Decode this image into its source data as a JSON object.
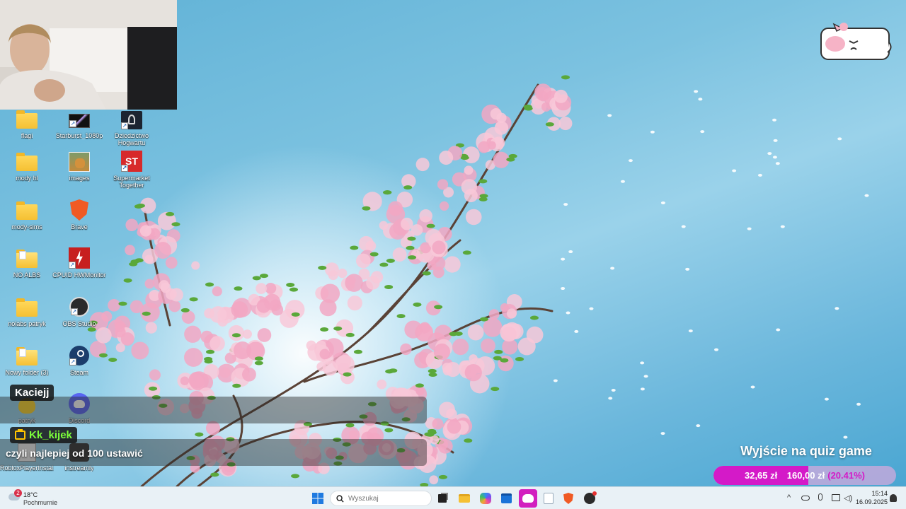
{
  "desktop_icons": [
    {
      "label": "flagi",
      "type": "folder",
      "col": 0,
      "row": 0
    },
    {
      "label": "Starburst_1080p",
      "type": "video",
      "col": 1,
      "row": 0
    },
    {
      "label": "Dziedzictwo Hogwartu",
      "type": "game",
      "col": 2,
      "row": 0
    },
    {
      "label": "mody hl",
      "type": "folder",
      "col": 0,
      "row": 1
    },
    {
      "label": "images",
      "type": "image",
      "col": 1,
      "row": 1
    },
    {
      "label": "Supermarket Together",
      "type": "st",
      "col": 2,
      "row": 1
    },
    {
      "label": "mody-sims",
      "type": "folder",
      "col": 0,
      "row": 2
    },
    {
      "label": "Brave",
      "type": "brave",
      "col": 1,
      "row": 2
    },
    {
      "label": "NO ALBS",
      "type": "folder-doc",
      "col": 0,
      "row": 3
    },
    {
      "label": "CPUID HWMonitor",
      "type": "hwmonitor",
      "col": 1,
      "row": 3
    },
    {
      "label": "nolabs patryk",
      "type": "folder",
      "col": 0,
      "row": 4
    },
    {
      "label": "OBS Studio",
      "type": "obs",
      "col": 1,
      "row": 4
    },
    {
      "label": "Nowy folder (3)",
      "type": "folder-doc",
      "col": 0,
      "row": 5
    },
    {
      "label": "Steam",
      "type": "steam",
      "col": 1,
      "row": 5
    },
    {
      "label": "patryk",
      "type": "avatar",
      "col": 0,
      "row": 6
    },
    {
      "label": "Discord",
      "type": "discord",
      "col": 1,
      "row": 6
    },
    {
      "label": "RobloxPlayerInstal...",
      "type": "roblox",
      "col": 0,
      "row": 7
    },
    {
      "label": "instreamly",
      "type": "instreamly",
      "col": 1,
      "row": 7
    }
  ],
  "chat": [
    {
      "user": "Kaciejj",
      "user_color": "#ffffff",
      "message": ""
    },
    {
      "user": "Kk_kijek",
      "user_color": "#7cff3a",
      "message": "czyli najlepiej od 100 ustawić"
    }
  ],
  "quiz": {
    "title": "Wyjście na quiz game",
    "current": "32,65 zł",
    "separator": "z",
    "goal": "160,00 zł",
    "percent_label": "(20.41%)",
    "progress": 0.2041
  },
  "taskbar": {
    "weather_temp": "18°C",
    "weather_desc": "Pochmurnie",
    "weather_badge": "2",
    "search_placeholder": "Wyszukaj",
    "time": "15:14",
    "date": "16.09.2025"
  },
  "colors": {
    "accent_magenta": "#d41ac8",
    "chat_green": "#7cff3a",
    "blossom": "#f2a7c3"
  }
}
